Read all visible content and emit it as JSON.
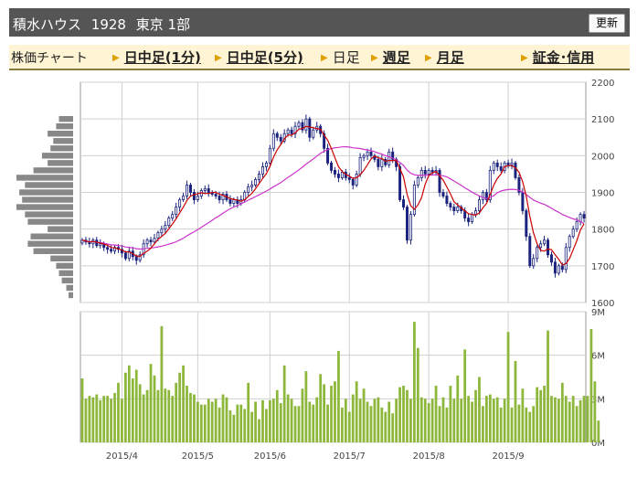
{
  "header": {
    "company": "積水ハウス",
    "code": "1928",
    "market": "東京 1部",
    "refresh_label": "更新"
  },
  "tabs": {
    "label": "株価チャート",
    "items": [
      {
        "label": "日中足(1分)",
        "active": false,
        "link": true
      },
      {
        "label": "日中足(5分)",
        "active": false,
        "link": true
      },
      {
        "label": "日足",
        "active": true,
        "link": false
      },
      {
        "label": "週足",
        "active": false,
        "link": true
      },
      {
        "label": "月足",
        "active": false,
        "link": true
      },
      {
        "label": "証金･信用",
        "active": false,
        "link": true
      }
    ]
  },
  "colors": {
    "header_bg": "#555555",
    "tab_bg": "#fff4d4",
    "candle": "#1a237e",
    "ma_short": "#cc0000",
    "ma_long": "#cc33cc",
    "volume": "#8db73a",
    "volume_profile": "#888888"
  },
  "chart_data": [
    {
      "type": "candlestick",
      "title": "",
      "ylim": [
        1600,
        2200
      ],
      "yticks": [
        "2200",
        "2100",
        "2000",
        "1900",
        "1800",
        "1700",
        "1600"
      ],
      "ma_short_label": "",
      "ma_long_label": "",
      "close": [
        1770,
        1765,
        1760,
        1770,
        1755,
        1760,
        1750,
        1745,
        1740,
        1750,
        1745,
        1735,
        1720,
        1740,
        1725,
        1715,
        1730,
        1760,
        1770,
        1765,
        1775,
        1790,
        1800,
        1810,
        1830,
        1840,
        1860,
        1880,
        1890,
        1920,
        1900,
        1880,
        1890,
        1905,
        1910,
        1900,
        1895,
        1890,
        1880,
        1895,
        1880,
        1870,
        1880,
        1870,
        1880,
        1900,
        1915,
        1920,
        1935,
        1950,
        1970,
        1980,
        2020,
        2060,
        2050,
        2040,
        2060,
        2070,
        2060,
        2080,
        2090,
        2070,
        2100,
        2050,
        2070,
        2080,
        2060,
        2020,
        1980,
        1960,
        1950,
        1940,
        1955,
        1940,
        1935,
        1920,
        1950,
        1995,
        2000,
        2010,
        2000,
        1990,
        1970,
        1990,
        1975,
        2010,
        1990,
        1970,
        1880,
        1860,
        1770,
        1840,
        1920,
        1940,
        1960,
        1950,
        1960,
        1955,
        1960,
        1900,
        1890,
        1870,
        1860,
        1850,
        1860,
        1850,
        1830,
        1820,
        1840,
        1850,
        1880,
        1900,
        1880,
        1960,
        1980,
        1970,
        1960,
        1980,
        1975,
        1980,
        1940,
        1900,
        1850,
        1780,
        1700,
        1720,
        1750,
        1760,
        1770,
        1730,
        1710,
        1680,
        1700,
        1690,
        1750,
        1780,
        1800,
        1820,
        1840,
        1830
      ],
      "volume_ylim": [
        0,
        9
      ],
      "volume_unit": "M",
      "volume_yticks": [
        "9M",
        "6M",
        "3M",
        "0M"
      ],
      "volume": [
        4.4,
        3.0,
        3.2,
        3.1,
        3.3,
        2.9,
        3.2,
        3.2,
        3.0,
        3.4,
        4.1,
        3.0,
        4.8,
        5.3,
        4.4,
        5.0,
        4.0,
        3.3,
        3.6,
        5.4,
        4.6,
        3.6,
        8.0,
        3.7,
        3.6,
        3.2,
        4.1,
        4.8,
        5.3,
        3.9,
        3.4,
        3.3,
        2.8,
        2.6,
        2.6,
        3.0,
        2.8,
        3.0,
        2.4,
        3.3,
        3.1,
        2.2,
        1.9,
        2.6,
        2.6,
        2.3,
        4.1,
        2.1,
        2.8,
        1.6,
        2.9,
        2.3,
        2.9,
        3.0,
        3.6,
        2.7,
        5.3,
        3.3,
        3.0,
        2.5,
        2.5,
        3.7,
        4.9,
        2.8,
        2.6,
        3.1,
        4.7,
        4.0,
        2.6,
        3.9,
        4.2,
        6.3,
        2.4,
        3.0,
        2.1,
        3.3,
        4.2,
        3.0,
        3.7,
        2.8,
        2.5,
        3.0,
        3.1,
        2.4,
        2.1,
        2.8,
        2.0,
        3.0,
        3.8,
        3.9,
        3.6,
        3.0,
        8.3,
        6.5,
        3.1,
        3.0,
        2.7,
        3.0,
        3.9,
        2.5,
        3.1,
        2.4,
        3.9,
        3.0,
        4.6,
        3.0,
        6.4,
        3.2,
        2.8,
        3.6,
        4.5,
        2.5,
        3.2,
        3.3,
        3.0,
        3.1,
        2.4,
        3.0,
        7.6,
        2.4,
        5.6,
        2.6,
        3.7,
        2.4,
        2.1,
        2.5,
        3.8,
        3.6,
        3.9,
        7.7,
        3.2,
        3.1,
        3.0,
        4.1,
        3.2,
        2.8,
        3.2,
        2.5,
        2.9,
        3.2,
        3.2,
        7.8,
        4.2,
        1.5
      ],
      "xticks": [
        {
          "label": "2015/4",
          "index": 11
        },
        {
          "label": "2015/5",
          "index": 32
        },
        {
          "label": "2015/6",
          "index": 52
        },
        {
          "label": "2015/7",
          "index": 74
        },
        {
          "label": "2015/8",
          "index": 96
        },
        {
          "label": "2015/9",
          "index": 118
        }
      ],
      "volume_profile": [
        {
          "price": 2100,
          "value": 0.25
        },
        {
          "price": 2080,
          "value": 0.3
        },
        {
          "price": 2060,
          "value": 0.45
        },
        {
          "price": 2040,
          "value": 0.35
        },
        {
          "price": 2020,
          "value": 0.4
        },
        {
          "price": 2000,
          "value": 0.55
        },
        {
          "price": 1980,
          "value": 0.45
        },
        {
          "price": 1960,
          "value": 0.7
        },
        {
          "price": 1940,
          "value": 1.0
        },
        {
          "price": 1920,
          "value": 0.85
        },
        {
          "price": 1900,
          "value": 0.95
        },
        {
          "price": 1880,
          "value": 0.9
        },
        {
          "price": 1860,
          "value": 1.0
        },
        {
          "price": 1840,
          "value": 0.85
        },
        {
          "price": 1820,
          "value": 0.8
        },
        {
          "price": 1800,
          "value": 0.45
        },
        {
          "price": 1780,
          "value": 0.75
        },
        {
          "price": 1760,
          "value": 0.8
        },
        {
          "price": 1740,
          "value": 0.7
        },
        {
          "price": 1720,
          "value": 0.4
        },
        {
          "price": 1700,
          "value": 0.3
        },
        {
          "price": 1680,
          "value": 0.25
        },
        {
          "price": 1660,
          "value": 0.2
        },
        {
          "price": 1640,
          "value": 0.12
        },
        {
          "price": 1620,
          "value": 0.08
        }
      ]
    }
  ]
}
